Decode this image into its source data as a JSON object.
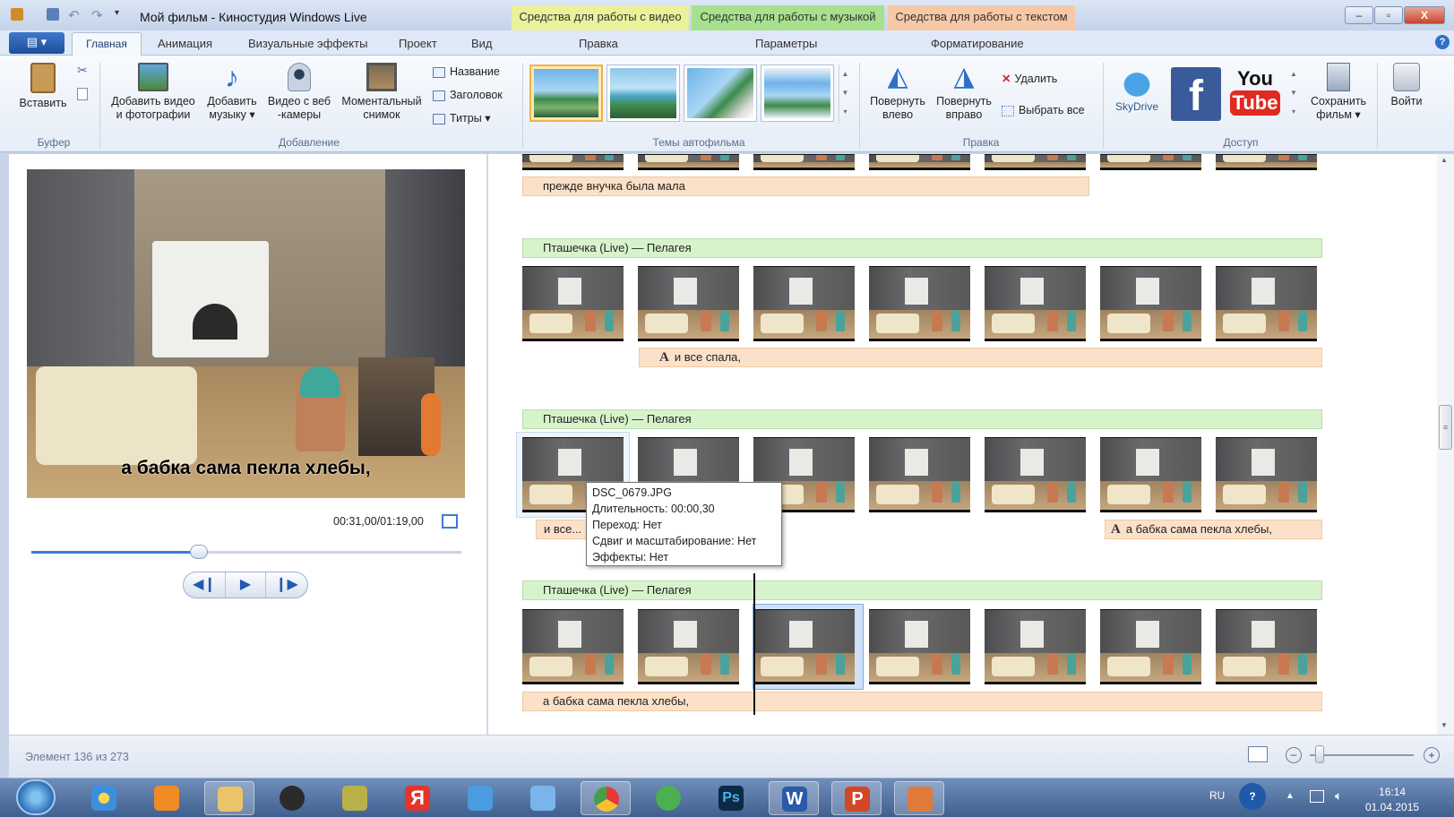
{
  "window": {
    "title": "Мой фильм - Киностудия Windows Live",
    "context_groups": [
      {
        "label": "Средства для работы с видео",
        "color": "#e9f19a",
        "tab": "Правка"
      },
      {
        "label": "Средства для работы с музыкой",
        "color": "#a7e08e",
        "tab": "Параметры"
      },
      {
        "label": "Средства для работы с текстом",
        "color": "#f6c8a6",
        "tab": "Форматирование"
      }
    ],
    "controls": {
      "minimize": "–",
      "maximize": "▫",
      "close": "X"
    }
  },
  "tabs": [
    "Главная",
    "Анимация",
    "Визуальные эффекты",
    "Проект",
    "Вид"
  ],
  "ribbon": {
    "clipboard": {
      "paste": "Вставить",
      "group": "Буфер"
    },
    "add": {
      "add_video": [
        "Добавить видео",
        "и фотографии"
      ],
      "add_music": [
        "Добавить",
        "музыку ▾"
      ],
      "webcam": [
        "Видео с веб",
        "-камеры"
      ],
      "snapshot": [
        "Моментальный",
        "снимок"
      ],
      "title": "Название",
      "caption": "Заголовок",
      "credits": "Титры ▾",
      "group": "Добавление"
    },
    "themes": {
      "group": "Темы автофильма"
    },
    "edit": {
      "rotate_left": [
        "Повернуть",
        "влево"
      ],
      "rotate_right": [
        "Повернуть",
        "вправо"
      ],
      "delete": "Удалить",
      "select_all": "Выбрать все",
      "group": "Правка"
    },
    "share": {
      "skydrive": "SkyDrive",
      "facebook": "f",
      "youtube": [
        "You",
        "Tube"
      ],
      "save_movie": [
        "Сохранить",
        "фильм ▾"
      ],
      "group": "Доступ"
    },
    "signin": "Войти"
  },
  "preview": {
    "caption": "а бабка сама пекла хлебы,",
    "timecode": "00:31,00/01:19,00",
    "progress": 0.39
  },
  "storyboard": {
    "top_text": "прежде внучка была мала",
    "rows": [
      {
        "music": "Пташечка (Live) — Пелагея",
        "text1": "",
        "text2": "и все спала,"
      },
      {
        "music": "Пташечка (Live) — Пелагея",
        "text1": "и все...",
        "text2": "а бабка сама пекла хлебы,"
      },
      {
        "music": "Пташечка (Live) — Пелагея",
        "text1": "а бабка сама пекла хлебы,",
        "text2": ""
      }
    ]
  },
  "tooltip": {
    "lines": [
      "DSC_0679.JPG",
      "Длительность: 00:00,30",
      "Переход: Нет",
      "Сдвиг и масштабирование: Нет",
      "Эффекты: Нет"
    ]
  },
  "status": {
    "text": "Элемент 136 из 273"
  },
  "taskbar": {
    "lang": "RU",
    "time": "16:14",
    "date": "01.04.2015"
  }
}
